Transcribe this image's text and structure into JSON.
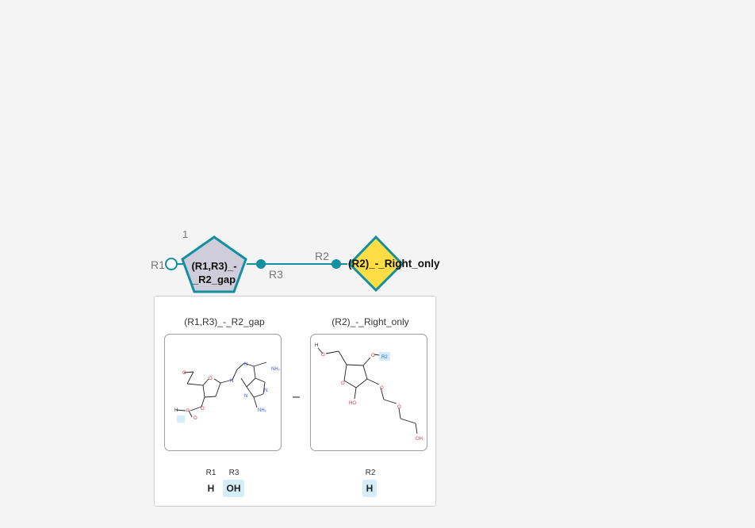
{
  "colors": {
    "link": "#128fa0",
    "node_border": "#128fa0",
    "sugar_fill": "#cfcdd9",
    "linker_fill": "#ffdd44",
    "highlight": "#d3eef9",
    "oxygen": "#e03232",
    "nitrogen": "#3050f8"
  },
  "sequence": {
    "position_index": "1",
    "monomers": [
      {
        "id": "(R1,R3)_-_R2_gap",
        "label_line1": "(R1,R3)_-",
        "label_line2": "_R2_gap",
        "shape": "pentagon"
      },
      {
        "id": "(R2)_-_Right_only",
        "label": "(R2)_-_Right_only",
        "shape": "diamond"
      }
    ],
    "attachment_labels": {
      "left_r1": "R1",
      "link_r3": "R3",
      "link_r2": "R2"
    }
  },
  "tooltip": {
    "separator": "–",
    "cards": [
      {
        "title": "(R1,R3)_-_R2_gap",
        "atoms": [
          "O",
          "O",
          "N",
          "N",
          "NH₂",
          "N",
          "N",
          "NH₂",
          "O",
          "P",
          "O",
          "H"
        ],
        "rgroups": [
          {
            "name": "R1",
            "value": "H",
            "highlight": false
          },
          {
            "name": "R3",
            "value": "OH",
            "highlight": true
          }
        ]
      },
      {
        "title": "(R2)_-_Right_only",
        "atoms": [
          "H",
          "O",
          "O",
          "R2",
          "O",
          "HO",
          "O",
          "O",
          "OH"
        ],
        "rgroups": [
          {
            "name": "R2",
            "value": "H",
            "highlight": true
          }
        ]
      }
    ]
  }
}
